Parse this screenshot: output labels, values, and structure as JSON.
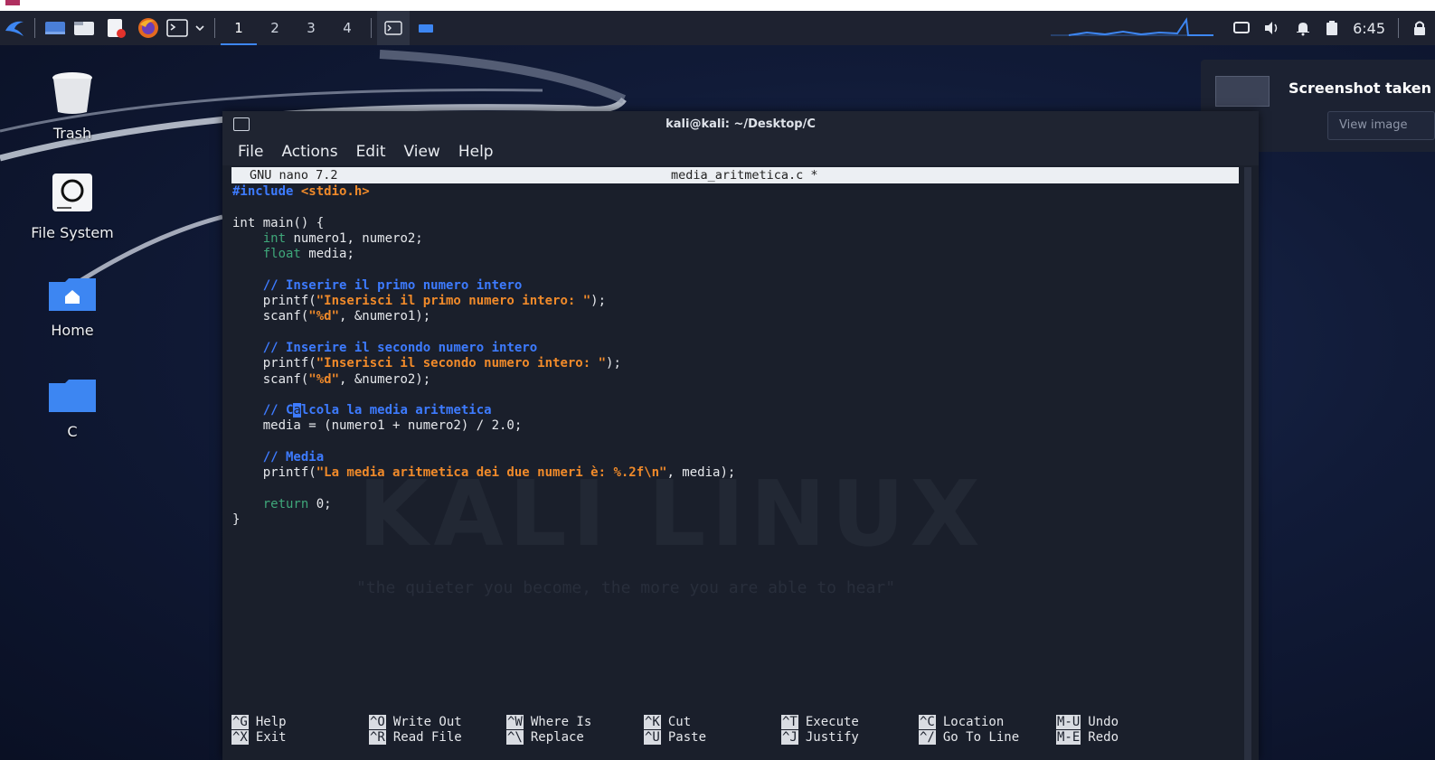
{
  "taskbar": {
    "workspaces": [
      "1",
      "2",
      "3",
      "4"
    ],
    "active_workspace": "1",
    "clock": "6:45",
    "icons": [
      "kali-menu-icon",
      "show-desktop-icon",
      "file-manager-icon",
      "text-editor-icon",
      "firefox-icon",
      "terminal-icon",
      "dropdown-icon"
    ]
  },
  "desktop": {
    "icons": [
      {
        "label": "Trash",
        "icon": "trash-icon"
      },
      {
        "label": "File System",
        "icon": "drive-icon"
      },
      {
        "label": "Home",
        "icon": "home-folder-icon"
      },
      {
        "label": "C",
        "icon": "folder-icon"
      }
    ]
  },
  "notification": {
    "title": "Screenshot taken",
    "button": "View image"
  },
  "terminal": {
    "title": "kali@kali: ~/Desktop/C",
    "menu": [
      "File",
      "Actions",
      "Edit",
      "View",
      "Help"
    ],
    "nano": {
      "version": "GNU nano 7.2",
      "filename": "media_aritmetica.c *"
    },
    "code_lines": [
      "#include <stdio.h>",
      "",
      "int main() {",
      "    int numero1, numero2;",
      "    float media;",
      "",
      "    // Inserire il primo numero intero",
      "    printf(\"Inserisci il primo numero intero: \");",
      "    scanf(\"%d\", &numero1);",
      "",
      "    // Inserire il secondo numero intero",
      "    printf(\"Inserisci il secondo numero intero: \");",
      "    scanf(\"%d\", &numero2);",
      "",
      "    // Calcola la media aritmetica",
      "    media = (numero1 + numero2) / 2.0;",
      "",
      "    // Media",
      "    printf(\"La media aritmetica dei due numeri è: %.2f\\n\", media);",
      "",
      "    return 0;",
      "}"
    ],
    "watermark": "KALI LINUX",
    "tagline": "\"the quieter you become, the more you are able to hear\"",
    "shortcuts": [
      {
        "key": "^G",
        "label": "Help"
      },
      {
        "key": "^O",
        "label": "Write Out"
      },
      {
        "key": "^W",
        "label": "Where Is"
      },
      {
        "key": "^K",
        "label": "Cut"
      },
      {
        "key": "^T",
        "label": "Execute"
      },
      {
        "key": "^C",
        "label": "Location"
      },
      {
        "key": "M-U",
        "label": "Undo"
      },
      {
        "key": "^X",
        "label": "Exit"
      },
      {
        "key": "^R",
        "label": "Read File"
      },
      {
        "key": "^\\",
        "label": "Replace"
      },
      {
        "key": "^U",
        "label": "Paste"
      },
      {
        "key": "^J",
        "label": "Justify"
      },
      {
        "key": "^/",
        "label": "Go To Line"
      },
      {
        "key": "M-E",
        "label": "Redo"
      }
    ]
  }
}
